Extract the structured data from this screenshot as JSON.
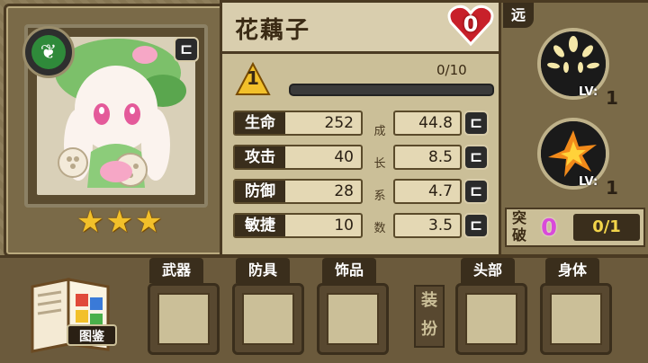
{
  "character": {
    "name": "花藕子",
    "stars": 3,
    "level": "1",
    "exp_text": "0/10",
    "exp_progress": 0.0,
    "heart_value": "0",
    "class_icon": "leaf-icon"
  },
  "stats": [
    {
      "label": "生命",
      "value": "252",
      "growth": "44.8"
    },
    {
      "label": "攻击",
      "value": "40",
      "growth": "8.5"
    },
    {
      "label": "防御",
      "value": "28",
      "growth": "4.7"
    },
    {
      "label": "敏捷",
      "value": "10",
      "growth": "3.5"
    }
  ],
  "growth_label_chars": [
    "成",
    "长",
    "系",
    "数"
  ],
  "skills": {
    "range_tag": "远",
    "lv_label": "LV:",
    "items": [
      {
        "name": "skill-1",
        "level": "1"
      },
      {
        "name": "skill-2",
        "level": "1"
      }
    ]
  },
  "breakthrough": {
    "label": "突破",
    "current": "0",
    "count": "0/1"
  },
  "equipment": {
    "codex_label": "图鉴",
    "dress_up_label": "装扮",
    "slots": [
      {
        "label": "武器"
      },
      {
        "label": "防具"
      },
      {
        "label": "饰品"
      },
      {
        "label": "头部"
      },
      {
        "label": "身体"
      }
    ]
  },
  "colors": {
    "panel_bg": "#cbbf98",
    "frame_dark": "#3a2e1c",
    "heart_red": "#c8202a",
    "star_gold": "#f2c02a",
    "leaf_green": "#2f8a3a",
    "breakthrough_pink": "#d94bd9"
  }
}
